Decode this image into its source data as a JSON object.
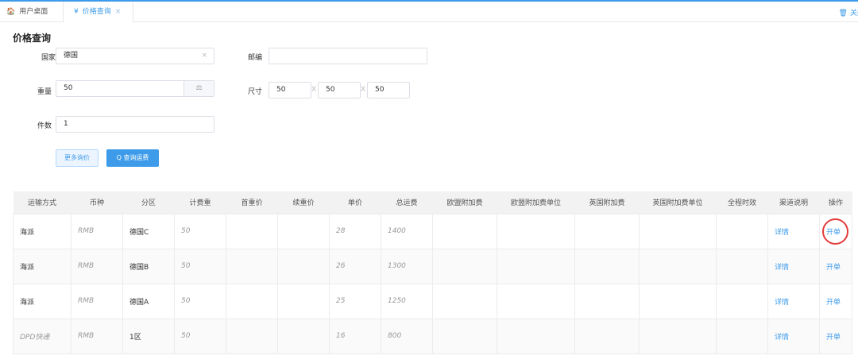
{
  "tabs": [
    {
      "label": "用户桌面",
      "icon": "home-icon",
      "glyph": "🏠"
    },
    {
      "label": "价格查询",
      "icon": "yen-icon",
      "glyph": "¥"
    }
  ],
  "tab_close_glyph": "×",
  "close_all_label": "关闭",
  "close_all_glyph": "🗑",
  "page_title": "价格查询",
  "form": {
    "country": {
      "label": "国家",
      "value": "德国",
      "clear": "×"
    },
    "postcode": {
      "label": "邮编",
      "value": ""
    },
    "weight": {
      "label": "重量",
      "value": "50",
      "unit_glyph": "⚖"
    },
    "size": {
      "label": "尺寸",
      "values": [
        "50",
        "50",
        "50"
      ],
      "sep": "X"
    },
    "pieces": {
      "label": "件数",
      "value": "1"
    }
  },
  "buttons": {
    "more": "更多询价",
    "query": "查询运费",
    "query_glyph": "Q"
  },
  "table": {
    "columns": [
      "运输方式",
      "币种",
      "分区",
      "计费重",
      "首重价",
      "续重价",
      "单价",
      "总运费",
      "欧盟附加费",
      "欧盟附加费单位",
      "英国附加费",
      "英国附加费单位",
      "全程时效",
      "渠道说明",
      "操作"
    ],
    "rows": [
      {
        "method": "海派",
        "currency": "RMB",
        "zone": "德国C",
        "weight": "50",
        "first": "",
        "next": "",
        "unit_price": "28",
        "total": "1400",
        "eu_fee": "",
        "eu_unit": "",
        "uk_fee": "",
        "uk_unit": "",
        "time": "",
        "detail": "详情",
        "action": "开单"
      },
      {
        "method": "海派",
        "currency": "RMB",
        "zone": "德国B",
        "weight": "50",
        "first": "",
        "next": "",
        "unit_price": "26",
        "total": "1300",
        "eu_fee": "",
        "eu_unit": "",
        "uk_fee": "",
        "uk_unit": "",
        "time": "",
        "detail": "详情",
        "action": "开单"
      },
      {
        "method": "海派",
        "currency": "RMB",
        "zone": "德国A",
        "weight": "50",
        "first": "",
        "next": "",
        "unit_price": "25",
        "total": "1250",
        "eu_fee": "",
        "eu_unit": "",
        "uk_fee": "",
        "uk_unit": "",
        "time": "",
        "detail": "详情",
        "action": "开单"
      },
      {
        "method": "DPD快递",
        "currency": "RMB",
        "zone": "1区",
        "weight": "50",
        "first": "",
        "next": "",
        "unit_price": "16",
        "total": "800",
        "eu_fee": "",
        "eu_unit": "",
        "uk_fee": "",
        "uk_unit": "",
        "time": "",
        "detail": "详情",
        "action": "开单"
      }
    ]
  },
  "colors": {
    "accent": "#3d9be9",
    "highlight_circle": "#e33a3a",
    "header_bg": "#f2f2f2"
  }
}
